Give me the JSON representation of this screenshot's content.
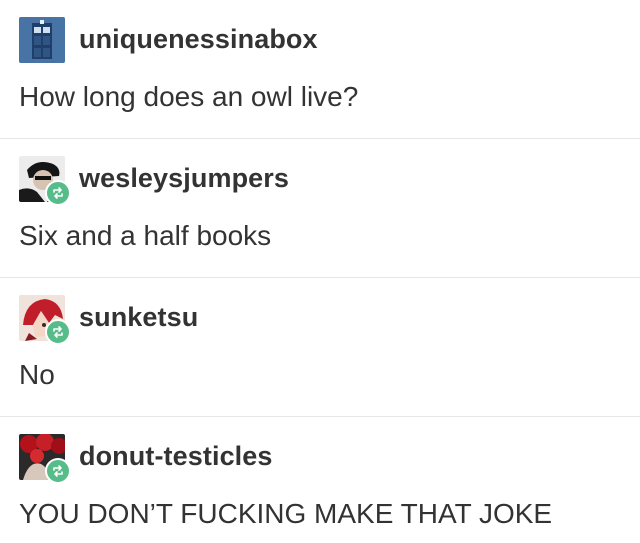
{
  "posts": [
    {
      "username": "uniquenessinabox",
      "text": "How long does an owl live?",
      "reblog": false,
      "avatar_icon": "tardis-avatar-icon",
      "avatar_colors": [
        "#2e4f7a",
        "#5a86b8"
      ]
    },
    {
      "username": "wesleysjumpers",
      "text": "Six and a half books",
      "reblog": true,
      "avatar_icon": "person-avatar-icon",
      "avatar_colors": [
        "#1d1d1d",
        "#d9d9d9"
      ]
    },
    {
      "username": "sunketsu",
      "text": "No",
      "reblog": true,
      "avatar_icon": "red-hair-avatar-icon",
      "avatar_colors": [
        "#c0202a",
        "#f2d7c8"
      ]
    },
    {
      "username": "donut-testicles",
      "text": "YOU DON’T FUCKING MAKE THAT JOKE",
      "reblog": true,
      "avatar_icon": "roses-avatar-icon",
      "avatar_colors": [
        "#a8141c",
        "#2a2a2a"
      ]
    }
  ],
  "reblog_color": "#56bc8a"
}
